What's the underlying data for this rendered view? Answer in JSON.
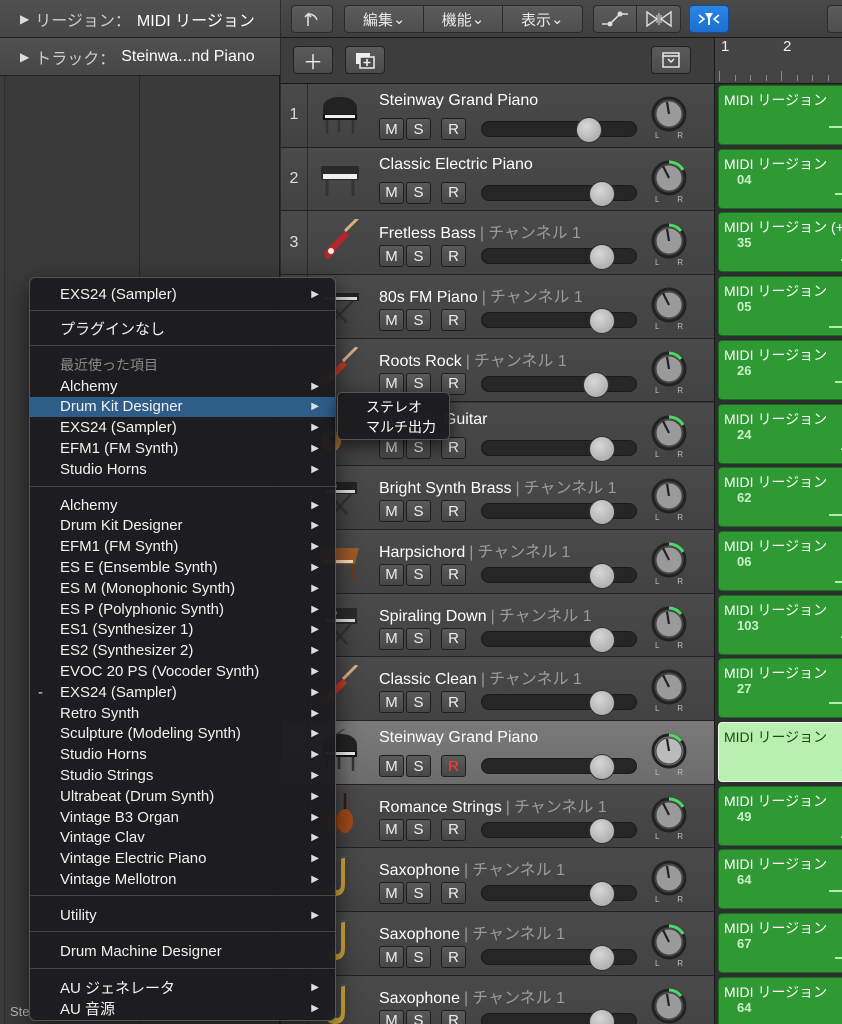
{
  "inspector": {
    "region_label": "リージョン：",
    "region_value": "MIDI リージョン",
    "track_label": "トラック：",
    "track_value": "Steinwa...nd Piano",
    "footer": "Ste"
  },
  "toolbar": {
    "edit": "編集",
    "functions": "機能",
    "view": "表示"
  },
  "ruler": {
    "bar1": "1",
    "bar2": "2"
  },
  "tracks": [
    {
      "num": "1",
      "name": "Steinway Grand Piano",
      "channel": "",
      "icon": "grand-piano-icon",
      "fader": 0.72,
      "rec_armed": false
    },
    {
      "num": "2",
      "name": "Classic Electric Piano",
      "channel": "",
      "icon": "electric-piano-icon",
      "fader": 0.82,
      "rec_armed": false
    },
    {
      "num": "3",
      "name": "Fretless Bass",
      "channel": "チャンネル 1",
      "icon": "bass-guitar-icon",
      "fader": 0.82,
      "rec_armed": false
    },
    {
      "num": "",
      "name": "80s FM Piano",
      "channel": "チャンネル 1",
      "icon": "keyboard-stand-icon",
      "fader": 0.82,
      "rec_armed": false
    },
    {
      "num": "",
      "name": "Roots Rock",
      "channel": "チャンネル 1",
      "icon": "electric-guitar-icon",
      "fader": 0.78,
      "rec_armed": false
    },
    {
      "num": "",
      "name": "Acoustic Guitar",
      "channel": "",
      "icon": "acoustic-guitar-icon",
      "fader": 0.82,
      "rec_armed": false
    },
    {
      "num": "",
      "name": "Bright Synth Brass",
      "channel": "チャンネル 1",
      "icon": "synth-icon",
      "fader": 0.82,
      "rec_armed": false
    },
    {
      "num": "",
      "name": "Harpsichord",
      "channel": "チャンネル 1",
      "icon": "harpsichord-icon",
      "fader": 0.82,
      "rec_armed": false
    },
    {
      "num": "",
      "name": "Spiraling Down",
      "channel": "チャンネル 1",
      "icon": "synth-stand-icon",
      "fader": 0.82,
      "rec_armed": false
    },
    {
      "num": "",
      "name": "Classic Clean",
      "channel": "チャンネル 1",
      "icon": "electric-guitar-icon",
      "fader": 0.82,
      "rec_armed": false
    },
    {
      "num": "",
      "name": "Steinway Grand Piano",
      "channel": "",
      "icon": "grand-piano-icon",
      "fader": 0.82,
      "rec_armed": true,
      "selected": true
    },
    {
      "num": "",
      "name": "Romance Strings",
      "channel": "チャンネル 1",
      "icon": "violins-icon",
      "fader": 0.82,
      "rec_armed": false
    },
    {
      "num": "",
      "name": "Saxophone",
      "channel": "チャンネル 1",
      "icon": "saxophone-icon",
      "fader": 0.82,
      "rec_armed": false
    },
    {
      "num": "",
      "name": "Saxophone",
      "channel": "チャンネル 1",
      "icon": "saxophone-icon",
      "fader": 0.82,
      "rec_armed": false
    },
    {
      "num": "",
      "name": "Saxophone",
      "channel": "チャンネル 1",
      "icon": "saxophone-icon",
      "fader": 0.82,
      "rec_armed": false
    }
  ],
  "msr_labels": {
    "mute": "M",
    "solo": "S",
    "record": "R"
  },
  "regions": [
    {
      "name": "MIDI リージョン",
      "num": ""
    },
    {
      "name": "MIDI リージョン",
      "num": "04"
    },
    {
      "name": "MIDI リージョン (+",
      "num": "35"
    },
    {
      "name": "MIDI リージョン",
      "num": "05"
    },
    {
      "name": "MIDI リージョン",
      "num": "26"
    },
    {
      "name": "MIDI リージョン",
      "num": "24"
    },
    {
      "name": "MIDI リージョン",
      "num": "62"
    },
    {
      "name": "MIDI リージョン",
      "num": "06"
    },
    {
      "name": "MIDI リージョン",
      "num": "103"
    },
    {
      "name": "MIDI リージョン",
      "num": "27"
    },
    {
      "name": "MIDI リージョン",
      "num": "",
      "selected": true
    },
    {
      "name": "MIDI リージョン",
      "num": "49"
    },
    {
      "name": "MIDI リージョン",
      "num": "64"
    },
    {
      "name": "MIDI リージョン",
      "num": "67"
    },
    {
      "name": "MIDI リージョン",
      "num": "64"
    }
  ],
  "menu": {
    "top_item": "EXS24  (Sampler)",
    "no_plugin": "プラグインなし",
    "recent_header": "最近使った項目",
    "recent": [
      "Alchemy",
      "Drum Kit Designer",
      "EXS24  (Sampler)",
      "EFM1  (FM Synth)",
      "Studio Horns"
    ],
    "instruments": [
      "Alchemy",
      "Drum Kit Designer",
      "EFM1  (FM Synth)",
      "ES E  (Ensemble Synth)",
      "ES M  (Monophonic Synth)",
      "ES P  (Polyphonic Synth)",
      "ES1  (Synthesizer 1)",
      "ES2  (Synthesizer 2)",
      "EVOC 20 PS  (Vocoder Synth)",
      "EXS24  (Sampler)",
      "Retro Synth",
      "Sculpture  (Modeling Synth)",
      "Studio Horns",
      "Studio Strings",
      "Ultrabeat  (Drum Synth)",
      "Vintage B3 Organ",
      "Vintage Clav",
      "Vintage Electric Piano",
      "Vintage Mellotron"
    ],
    "current_marker": "-",
    "utility": "Utility",
    "drum_machine": "Drum Machine Designer",
    "au_generator": "AU ジェネレータ",
    "au_instrument": "AU 音源"
  },
  "submenu": {
    "stereo": "ステレオ",
    "multi": "マルチ出力"
  },
  "colors": {
    "region_green": "#2f9a33",
    "highlight_blue": "#2e5d8a",
    "record_red": "#ff3b30",
    "tool_blue": "#1a73d9"
  }
}
